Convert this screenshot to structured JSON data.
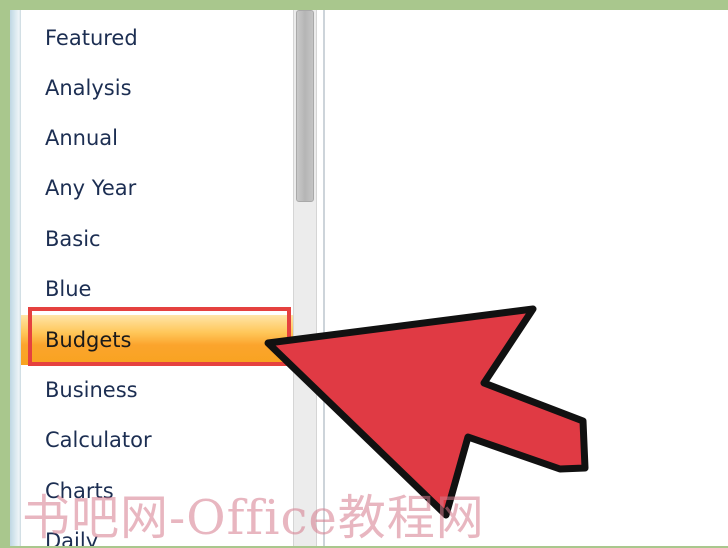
{
  "category_list": {
    "items": [
      {
        "label": "Featured"
      },
      {
        "label": "Analysis"
      },
      {
        "label": "Annual"
      },
      {
        "label": "Any Year"
      },
      {
        "label": "Basic"
      },
      {
        "label": "Blue"
      },
      {
        "label": "Budgets",
        "selected": true
      },
      {
        "label": "Business"
      },
      {
        "label": "Calculator"
      },
      {
        "label": "Charts"
      },
      {
        "label": "Daily"
      }
    ],
    "selected_label": "Budgets"
  },
  "annotation": {
    "arrow_icon": "pointer-arrow-icon",
    "arrow_color": "#e03a44",
    "highlight_color": "#e5413f"
  },
  "watermark": {
    "text": "书吧网-Office教程网"
  }
}
